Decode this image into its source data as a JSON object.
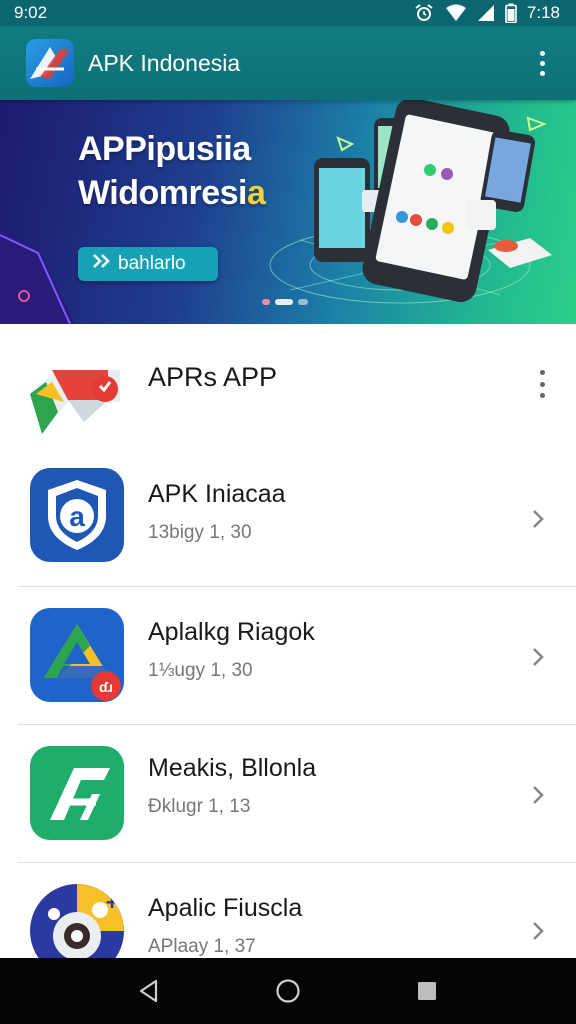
{
  "status_bar": {
    "left_time": "9:02",
    "right_time": "7:18"
  },
  "app_bar": {
    "title": "APK Indonesia",
    "logo_icon": "apk-logo-icon",
    "overflow_icon": "more-vert-icon"
  },
  "banner": {
    "line1": "APPipusiia",
    "line2_main": "Widomresi",
    "line2_highlight": "a",
    "cta_label": "bahlarlo",
    "cta_icon": "double-chevron-icon",
    "slide_count": 3,
    "active_slide": 2
  },
  "apps": [
    {
      "name": "APRs APP",
      "subtitle": "",
      "icon": "google-style-arrow-icon",
      "action": "more-vert-icon"
    },
    {
      "name": "APK Iniacaa",
      "subtitle": "13bigy 1, 30",
      "icon": "shield-a-icon",
      "action": "chevron-right-icon"
    },
    {
      "name": "Aplalkg Riagok",
      "subtitle": "1⅓ugy 1, 30",
      "icon": "drive-triangle-icon",
      "action": "chevron-right-icon"
    },
    {
      "name": "Meakis, Bllonla",
      "subtitle": "Ɖklugr 1, 13",
      "icon": "green-a-icon",
      "action": "chevron-right-icon"
    },
    {
      "name": "Apalic Fiuscla",
      "subtitle": "APlaay 1, 37",
      "icon": "camera-badge-icon",
      "action": "chevron-right-icon"
    }
  ],
  "nav_bar": {
    "back_icon": "back-triangle-icon",
    "home_icon": "home-circle-icon",
    "recents_icon": "recents-square-icon"
  },
  "colors": {
    "app_bar": "#117c82",
    "status_bar": "#0b6670",
    "cta": "#17a1b5",
    "highlight": "#f4d03f"
  }
}
